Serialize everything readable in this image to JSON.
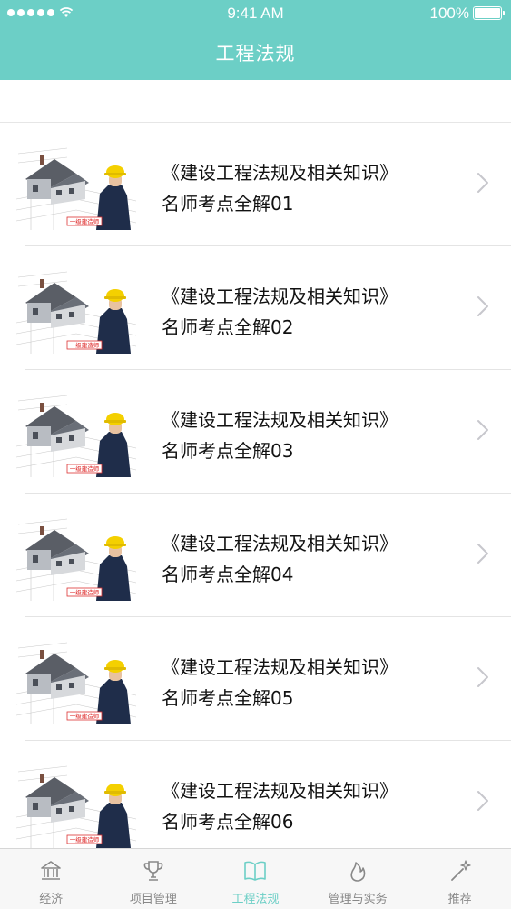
{
  "status_bar": {
    "signal": "●●●●●",
    "time": "9:41 AM",
    "battery": "100%"
  },
  "header": {
    "title": "工程法规"
  },
  "colors": {
    "accent": "#6ccfc6",
    "tab_inactive": "#888888"
  },
  "list": {
    "items": [
      {
        "title": "《建设工程法规及相关知识》",
        "subtitle": "名师考点全解01",
        "thumb_caption": "一级建造师"
      },
      {
        "title": "《建设工程法规及相关知识》",
        "subtitle": "名师考点全解02",
        "thumb_caption": "一级建造师"
      },
      {
        "title": "《建设工程法规及相关知识》",
        "subtitle": "名师考点全解03",
        "thumb_caption": "一级建造师"
      },
      {
        "title": "《建设工程法规及相关知识》",
        "subtitle": "名师考点全解04",
        "thumb_caption": "一级建造师"
      },
      {
        "title": "《建设工程法规及相关知识》",
        "subtitle": "名师考点全解05",
        "thumb_caption": "一级建造师"
      },
      {
        "title": "《建设工程法规及相关知识》",
        "subtitle": "名师考点全解06",
        "thumb_caption": "一级建造师"
      }
    ]
  },
  "tabbar": {
    "tabs": [
      {
        "label": "经济",
        "icon": "bank-icon",
        "active": false
      },
      {
        "label": "项目管理",
        "icon": "trophy-icon",
        "active": false
      },
      {
        "label": "工程法规",
        "icon": "book-icon",
        "active": true
      },
      {
        "label": "管理与实务",
        "icon": "flame-icon",
        "active": false
      },
      {
        "label": "推荐",
        "icon": "magic-wand-icon",
        "active": false
      }
    ]
  }
}
